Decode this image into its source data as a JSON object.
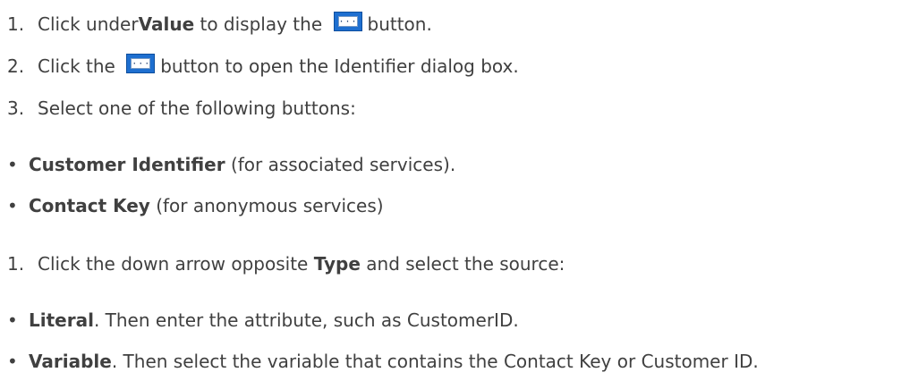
{
  "steps_1": [
    {
      "number": "1.",
      "pre": "Click under ",
      "bold": "Value",
      "mid": " to display the ",
      "post": " button."
    },
    {
      "number": "2.",
      "pre": "Click the ",
      "post": " button to open the Identifier dialog box."
    },
    {
      "number": "3.",
      "text": "Select one of the following buttons:"
    }
  ],
  "bullets_1": [
    {
      "bullet": "•",
      "bold": "Customer Identifier",
      "text": " (for associated services)."
    },
    {
      "bullet": "•",
      "bold": "Contact Key",
      "text": " (for anonymous services)"
    }
  ],
  "steps_2": [
    {
      "number": "1.",
      "pre": "Click the down arrow opposite ",
      "bold": "Type",
      "post": " and select the source:"
    }
  ],
  "bullets_2": [
    {
      "bullet": "•",
      "bold": "Literal",
      "text": ". Then enter the attribute, such as CustomerID."
    },
    {
      "bullet": "•",
      "bold": "Variable",
      "text": ". Then select the variable that contains the Contact Key or Customer ID."
    }
  ],
  "icon": {
    "name": "browse-button-icon",
    "glyph": "···"
  }
}
